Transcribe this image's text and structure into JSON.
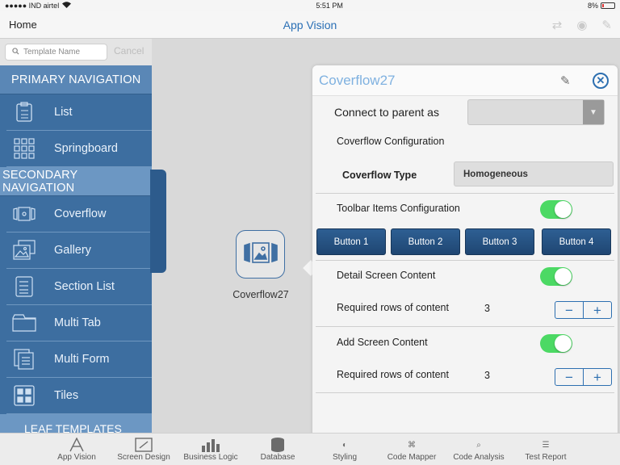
{
  "status_bar": {
    "carrier": "●●●●● IND airtel",
    "time": "5:51 PM",
    "battery": "8%"
  },
  "nav": {
    "back": "Home",
    "title": "App Vision"
  },
  "search": {
    "placeholder": "Template Name",
    "cancel": "Cancel"
  },
  "sidebar": {
    "primary_header": "PRIMARY NAVIGATION",
    "primary_items": [
      {
        "label": "List",
        "icon": "list-icon"
      },
      {
        "label": "Springboard",
        "icon": "grid-icon"
      }
    ],
    "secondary_header": "SECONDARY NAVIGATION",
    "secondary_items": [
      {
        "label": "Coverflow",
        "icon": "coverflow-icon"
      },
      {
        "label": "Gallery",
        "icon": "gallery-icon"
      },
      {
        "label": "Section List",
        "icon": "section-list-icon"
      },
      {
        "label": "Multi Tab",
        "icon": "multi-tab-icon"
      },
      {
        "label": "Multi Form",
        "icon": "multi-form-icon"
      },
      {
        "label": "Tiles",
        "icon": "tiles-icon"
      }
    ],
    "leaf_header": "LEAF TEMPLATES"
  },
  "canvas": {
    "node_label": "Coverflow27"
  },
  "popover": {
    "title": "Coverflow27",
    "connect_label": "Connect to parent as",
    "config_label": "Coverflow Configuration",
    "type_label": "Coverflow Type",
    "type_value": "Homogeneous",
    "toolbar_label": "Toolbar Items Configuration",
    "toolbar_enabled": true,
    "buttons": [
      "Button 1",
      "Button 2",
      "Button 3",
      "Button 4"
    ],
    "detail_label": "Detail Screen Content",
    "detail_enabled": true,
    "detail_rows_label": "Required rows of content",
    "detail_rows_value": "3",
    "add_label": "Add Screen Content",
    "add_enabled": true,
    "add_rows_label": "Required rows of content",
    "add_rows_value": "3",
    "minus": "−",
    "plus": "+"
  },
  "tabbar": {
    "tabs": [
      "App Vision",
      "Screen Design",
      "Business Logic",
      "Database",
      "Styling",
      "Code Mapper",
      "Code Analysis",
      "Test Report"
    ]
  },
  "colors": {
    "accent": "#2a6fb5",
    "sidebar": "#3d6ea0",
    "toggle_on": "#4cd964"
  }
}
